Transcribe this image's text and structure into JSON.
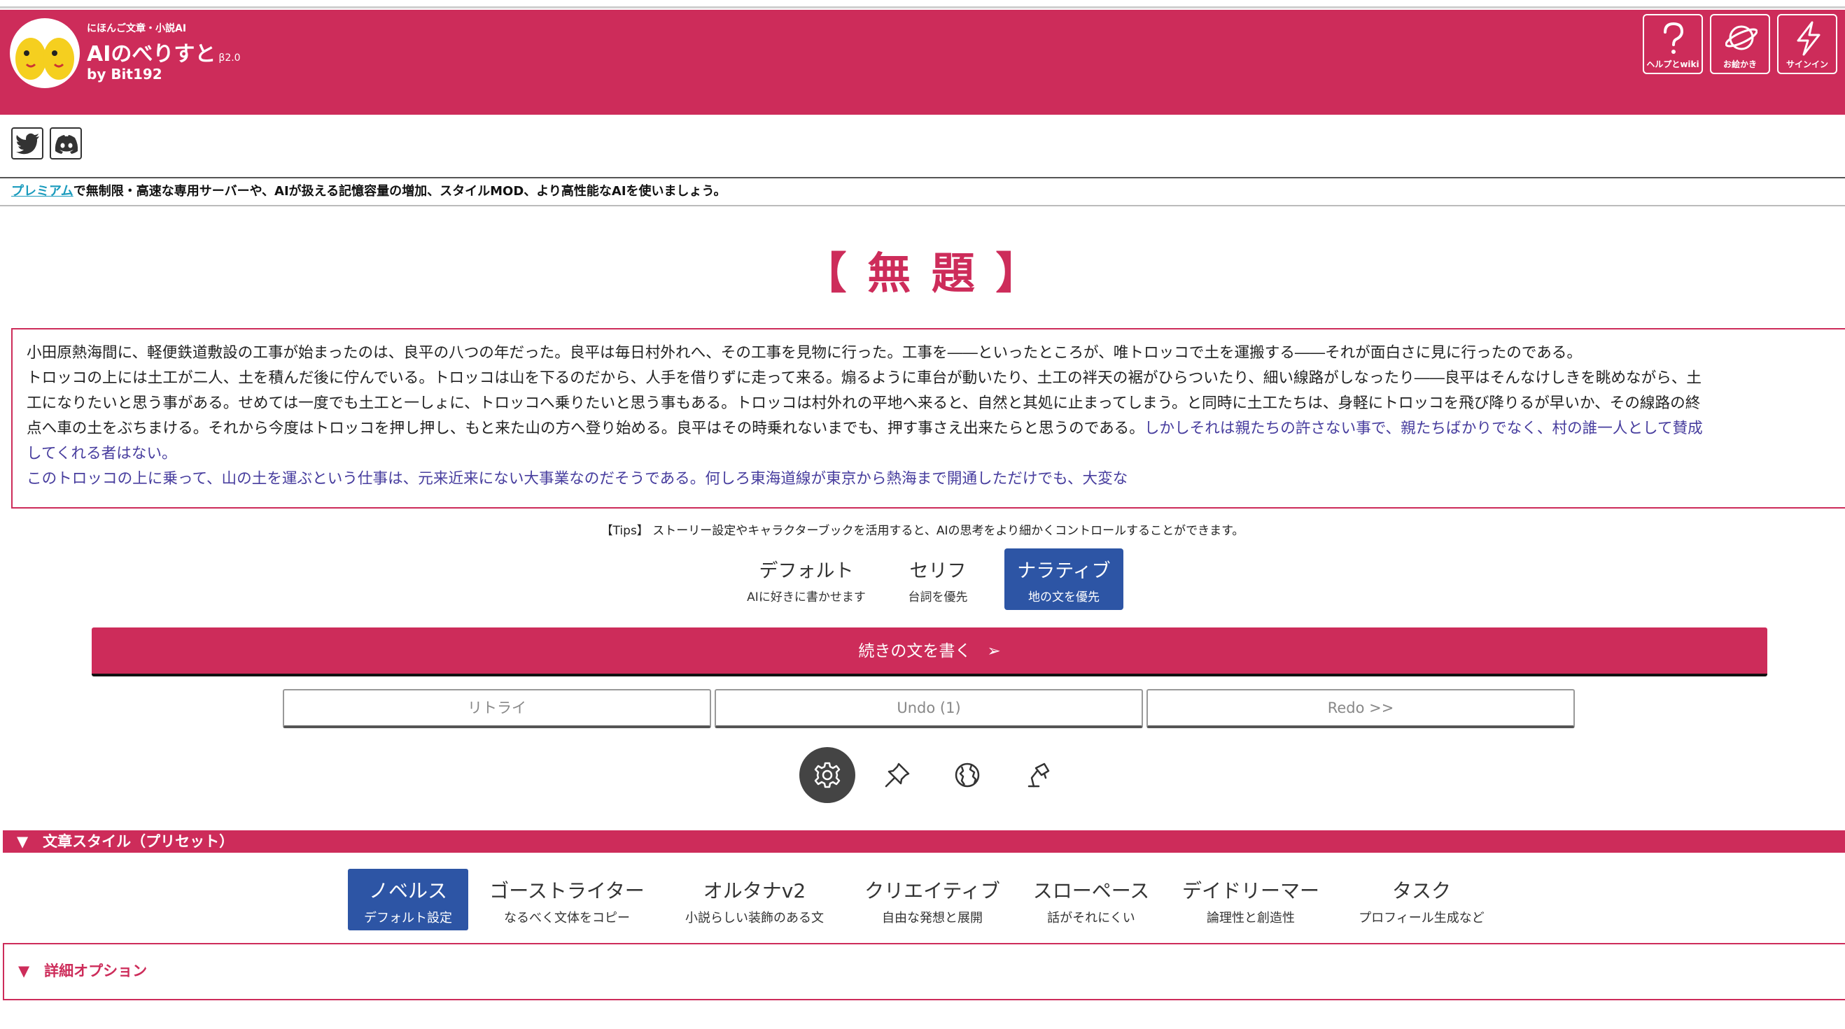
{
  "header": {
    "subtitle": "にほんご文章・小説AI",
    "title": "AIのべりすと",
    "version": "β2.0",
    "byline": "by Bit192",
    "buttons": [
      {
        "label": "ヘルプとwiki",
        "icon": "question-icon"
      },
      {
        "label": "お絵かき",
        "icon": "planet-icon"
      },
      {
        "label": "サインイン",
        "icon": "lightning-icon"
      }
    ],
    "brand_color": "#cd2c5a"
  },
  "social": {
    "icons": [
      "twitter-icon",
      "discord-icon"
    ]
  },
  "promo": {
    "link": "プレミアム",
    "text": "で無制限・高速な専用サーバーや、AIが扱える記憶容量の増加、スタイルMOD、より高性能なAIを使いましょう。"
  },
  "story": {
    "title": "【 無 題 】",
    "lines": [
      {
        "text": "小田原熱海間に、軽便鉄道敷設の工事が始まったのは、良平の八つの年だった。良平は毎日村外れへ、その工事を見物に行った。工事を――といったところが、唯トロッコで土を運搬する――それが面白さに見に行ったのである。",
        "ai": ""
      },
      {
        "text": "トロッコの上には土工が二人、土を積んだ後に佇んでいる。トロッコは山を下るのだから、人手を借りずに走って来る。煽るように車台が動いたり、土工の袢天の裾がひらついたり、細い線路がしなったり――良平はそんなけしきを眺めながら、土工になりたいと思う事がある。せめては一度でも土工と一しょに、トロッコへ乗りたいと思う事もある。トロッコは村外れの平地へ来ると、自然と其処に止まってしまう。と同時に土工たちは、身軽にトロッコを飛び降りるが早いか、その線路の終点へ車の土をぶちまける。それから今度はトロッコを押し押し、もと来た山の方へ登り始める。良平はその時乗れないまでも、押す事さえ出来たらと思うのである。",
        "ai": "しかしそれは親たちの許さない事で、親たちばかりでなく、村の誰一人として賛成してくれる者はない。"
      },
      {
        "text": "",
        "ai": "このトロッコの上に乗って、山の土を運ぶという仕事は、元来近来にない大事業なのだそうである。何しろ東海道線が東京から熱海まで開通しただけでも、大変な"
      }
    ],
    "ai_text_color": "#473d9e"
  },
  "tips": "【Tips】 ストーリー設定やキャラクターブックを活用すると、AIの思考をより細かくコントロールすることができます。",
  "modes": [
    {
      "label": "デフォルト",
      "sub": "AIに好きに書かせます",
      "active": false
    },
    {
      "label": "セリフ",
      "sub": "台詞を優先",
      "active": false
    },
    {
      "label": "ナラティブ",
      "sub": "地の文を優先",
      "active": true
    }
  ],
  "write_button": "続きの文を書く　➢",
  "controls": {
    "retry": "リトライ",
    "undo": "Undo (1)",
    "redo": "Redo >>"
  },
  "tool_icons": [
    "gear-icon",
    "pin-icon",
    "globe-icon",
    "lamp-icon"
  ],
  "style_section": {
    "heading": "▼　文章スタイル（プリセット）",
    "presets": [
      {
        "label": "ノベルス",
        "sub": "デフォルト設定",
        "active": true
      },
      {
        "label": "ゴーストライター",
        "sub": "なるべく文体をコピー",
        "active": false
      },
      {
        "label": "オルタナv2",
        "sub": "小説らしい装飾のある文",
        "active": false
      },
      {
        "label": "クリエイティブ",
        "sub": "自由な発想と展開",
        "active": false
      },
      {
        "label": "スローペース",
        "sub": "話がそれにくい",
        "active": false
      },
      {
        "label": "デイドリーマー",
        "sub": "論理性と創造性",
        "active": false
      },
      {
        "label": "タスク",
        "sub": "プロフィール生成など",
        "active": false
      }
    ]
  },
  "details": "▼　詳細オプション"
}
